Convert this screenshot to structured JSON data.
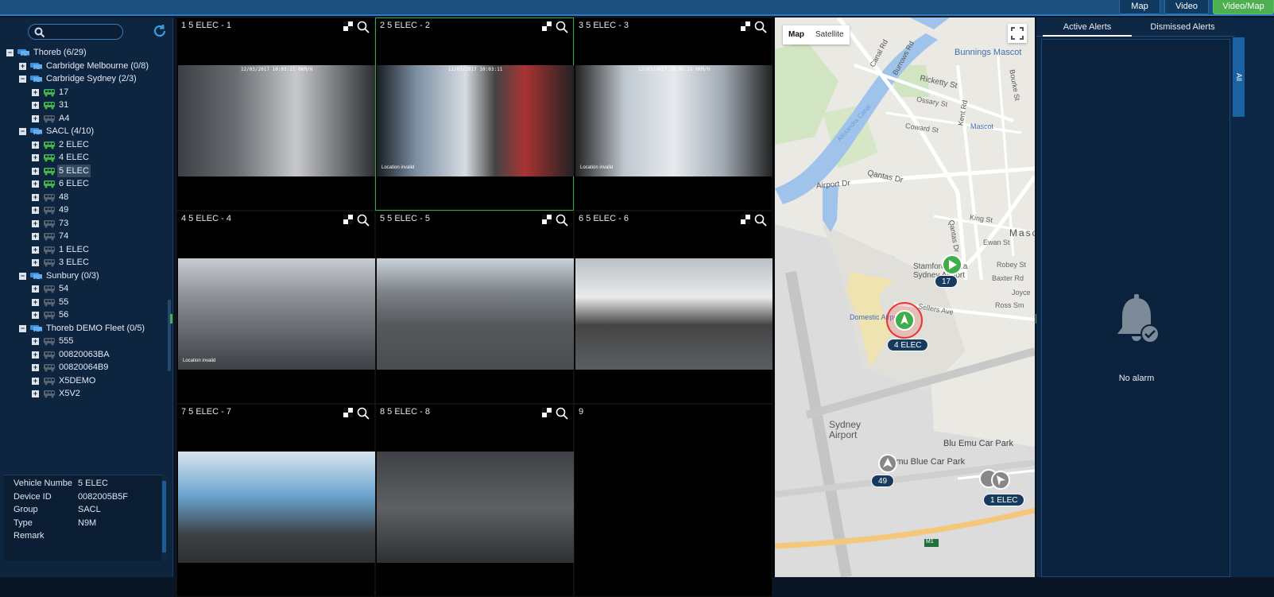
{
  "topbar": {
    "buttons": [
      "Map",
      "Video",
      "Video/Map"
    ]
  },
  "tree": [
    {
      "label": "Thoreb (6/29)",
      "level": 0,
      "type": "group",
      "state": "-"
    },
    {
      "label": "Carbridge Melbourne (0/8)",
      "level": 1,
      "type": "group",
      "state": "+"
    },
    {
      "label": "Carbridge Sydney (2/3)",
      "level": 1,
      "type": "group",
      "state": "-"
    },
    {
      "label": "17",
      "level": 2,
      "type": "vehicle",
      "online": true
    },
    {
      "label": "31",
      "level": 2,
      "type": "vehicle",
      "online": true
    },
    {
      "label": "A4",
      "level": 2,
      "type": "vehicle",
      "online": false
    },
    {
      "label": "SACL (4/10)",
      "level": 1,
      "type": "group",
      "state": "-"
    },
    {
      "label": "2 ELEC",
      "level": 2,
      "type": "vehicle",
      "online": true
    },
    {
      "label": "4 ELEC",
      "level": 2,
      "type": "vehicle",
      "online": true
    },
    {
      "label": "5 ELEC",
      "level": 2,
      "type": "vehicle",
      "online": true,
      "selected": true
    },
    {
      "label": "6 ELEC",
      "level": 2,
      "type": "vehicle",
      "online": true
    },
    {
      "label": "48",
      "level": 2,
      "type": "vehicle",
      "online": false
    },
    {
      "label": "49",
      "level": 2,
      "type": "vehicle",
      "online": false
    },
    {
      "label": "73",
      "level": 2,
      "type": "vehicle",
      "online": false
    },
    {
      "label": "74",
      "level": 2,
      "type": "vehicle",
      "online": false
    },
    {
      "label": "1 ELEC",
      "level": 2,
      "type": "vehicle",
      "online": false
    },
    {
      "label": "3 ELEC",
      "level": 2,
      "type": "vehicle",
      "online": false
    },
    {
      "label": "Sunbury (0/3)",
      "level": 1,
      "type": "group",
      "state": "-"
    },
    {
      "label": "54",
      "level": 2,
      "type": "vehicle",
      "online": false
    },
    {
      "label": "55",
      "level": 2,
      "type": "vehicle",
      "online": false
    },
    {
      "label": "56",
      "level": 2,
      "type": "vehicle",
      "online": false
    },
    {
      "label": "Thoreb DEMO Fleet (0/5)",
      "level": 1,
      "type": "group",
      "state": "-"
    },
    {
      "label": "555",
      "level": 2,
      "type": "vehicle",
      "online": false
    },
    {
      "label": "00820063BA",
      "level": 2,
      "type": "vehicle",
      "online": false
    },
    {
      "label": "00820064B9",
      "level": 2,
      "type": "vehicle",
      "online": false
    },
    {
      "label": "X5DEMO",
      "level": 2,
      "type": "vehicle",
      "online": false
    },
    {
      "label": "X5V2",
      "level": 2,
      "type": "vehicle",
      "online": false
    }
  ],
  "info": [
    {
      "label": "Vehicle Numbe",
      "value": "5 ELEC"
    },
    {
      "label": "Device ID",
      "value": "0082005B5F"
    },
    {
      "label": "Group",
      "value": "SACL"
    },
    {
      "label": "Type",
      "value": "N9M"
    },
    {
      "label": "Remark",
      "value": ""
    }
  ],
  "cells": [
    {
      "label": "1 5 ELEC - 1",
      "feed": true,
      "osd": "12/03/2017 10:03:11       0KM/H",
      "loc": ""
    },
    {
      "label": "2 5 ELEC - 2",
      "feed": true,
      "active": true,
      "osd": "12/03/2017 10:03:11",
      "loc": "Location invalid"
    },
    {
      "label": "3 5 ELEC - 3",
      "feed": true,
      "osd": "12/03/2017 10:03:11       0KM/H",
      "loc": "Location invalid"
    },
    {
      "label": "4 5 ELEC - 4",
      "feed": true,
      "osd": "",
      "loc": "Location invalid"
    },
    {
      "label": "5 5 ELEC - 5",
      "feed": true,
      "osd": "",
      "loc": ""
    },
    {
      "label": "6 5 ELEC - 6",
      "feed": true,
      "osd": "",
      "loc": ""
    },
    {
      "label": "7 5 ELEC - 7",
      "feed": true,
      "osd": "",
      "loc": ""
    },
    {
      "label": "8 5 ELEC - 8",
      "feed": true,
      "osd": "",
      "loc": ""
    },
    {
      "label": "9",
      "feed": false
    }
  ],
  "map": {
    "tabs": [
      "Map",
      "Satellite"
    ],
    "labels": [
      {
        "text": "Bunnings Mascot",
        "color": "#3b6fb5"
      },
      {
        "text": "Ricketty St",
        "color": "#555"
      },
      {
        "text": "Ossary St",
        "color": "#666"
      },
      {
        "text": "Coward St",
        "color": "#666"
      },
      {
        "text": "Mascot",
        "color": "#3b6fb5"
      },
      {
        "text": "Qantas Dr",
        "color": "#555"
      },
      {
        "text": "Airport Dr",
        "color": "#555"
      },
      {
        "text": "King St",
        "color": "#666"
      },
      {
        "text": "Ewan St",
        "color": "#666"
      },
      {
        "text": "Masco",
        "color": "#555"
      },
      {
        "text": "Stamford Plaza Sydney Airport",
        "color": "#555"
      },
      {
        "text": "Robey St",
        "color": "#666"
      },
      {
        "text": "Baxter Rd",
        "color": "#666"
      },
      {
        "text": "Joyce",
        "color": "#666"
      },
      {
        "text": "Ross Sm",
        "color": "#666"
      },
      {
        "text": "Sellers Ave",
        "color": "#666"
      },
      {
        "text": "Domestic Airport",
        "color": "#3b6fb5"
      },
      {
        "text": "Sydney Airport",
        "color": "#555"
      },
      {
        "text": "Blu Emu Car Park",
        "color": "#444"
      },
      {
        "text": "Emu Blue Car Park",
        "color": "#444"
      },
      {
        "text": "Alexandra Canal",
        "color": "#7aa8d8"
      },
      {
        "text": "Canal Rd",
        "color": "#555"
      },
      {
        "text": "Burrows Rd",
        "color": "#555"
      },
      {
        "text": "Kent Rd",
        "color": "#555"
      },
      {
        "text": "Bourke St",
        "color": "#555"
      },
      {
        "text": "Qantas Dr",
        "color": "#555"
      },
      {
        "text": "M1",
        "color": "#fff"
      }
    ],
    "markers": [
      {
        "label": "17",
        "kind": "green"
      },
      {
        "label": "4 ELEC",
        "kind": "alarm"
      },
      {
        "label": "49",
        "kind": "grey"
      },
      {
        "label": "1 ELEC",
        "kind": "grey"
      }
    ]
  },
  "alerts": {
    "tabs": [
      "Active Alerts",
      "Dismissed Alerts"
    ],
    "empty_text": "No alarm",
    "side_tab": "All"
  }
}
